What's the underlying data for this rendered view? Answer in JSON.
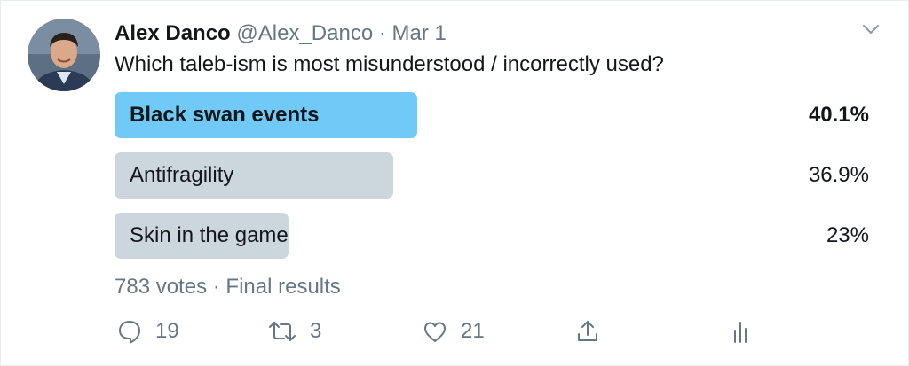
{
  "tweet": {
    "author_name": "Alex Danco",
    "handle": "@Alex_Danco",
    "separator": "·",
    "date": "Mar 1",
    "text": "Which taleb-ism is most misunderstood / incorrectly used?"
  },
  "poll": {
    "options": [
      {
        "label": "Black swan events",
        "percent_text": "40.1%",
        "percent": 40.1,
        "fill_fraction": 0.401,
        "winner": true
      },
      {
        "label": "Antifragility",
        "percent_text": "36.9%",
        "percent": 36.9,
        "fill_fraction": 0.369,
        "winner": false
      },
      {
        "label": "Skin in the game",
        "percent_text": "23%",
        "percent": 23,
        "fill_fraction": 0.23,
        "winner": false
      }
    ],
    "votes": "783 votes",
    "separator": "·",
    "status": "Final results"
  },
  "actions": {
    "reply_count": "19",
    "retweet_count": "3",
    "like_count": "21"
  },
  "colors": {
    "winner_bar": "#71c9f8",
    "other_bar": "#ccd6dd",
    "secondary_text": "#657786",
    "primary_text": "#14171a"
  },
  "icons": {
    "reply": "reply-icon",
    "retweet": "retweet-icon",
    "like": "heart-icon",
    "share": "share-icon",
    "analytics": "analytics-icon",
    "menu": "chevron-down-icon"
  }
}
